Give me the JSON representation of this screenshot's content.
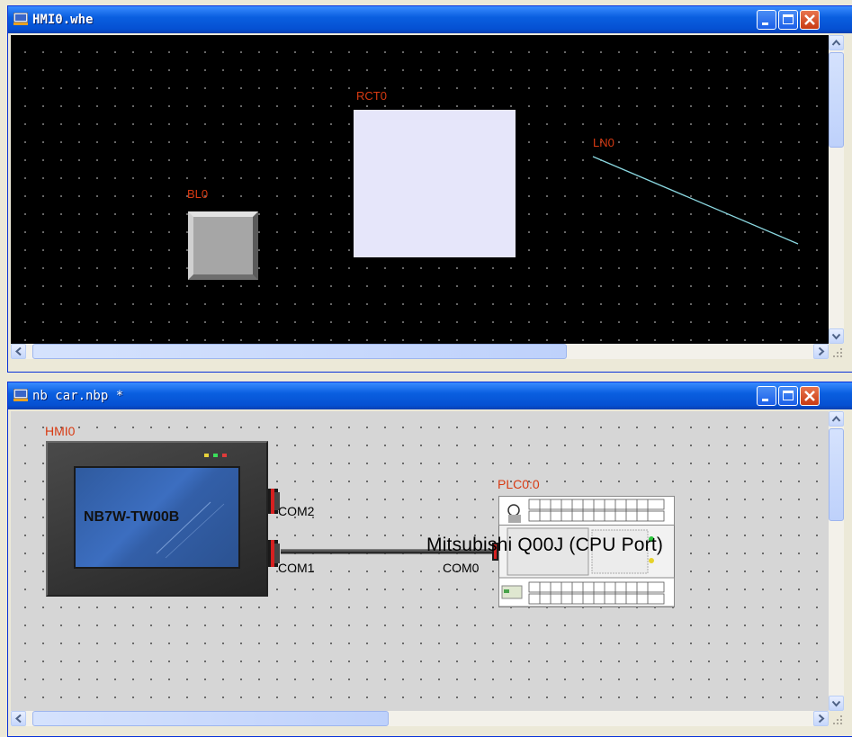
{
  "window1": {
    "title": "HMI0.whe",
    "objects": {
      "button_label": "BL0",
      "rect_label": "RCT0",
      "line_label": "LN0"
    }
  },
  "window2": {
    "title": "nb car.nbp *",
    "hmi": {
      "label": "HMI0",
      "model": "NB7W-TW00B",
      "ports": [
        "COM2",
        "COM1"
      ]
    },
    "plc": {
      "label": "PLC0:0",
      "model": "Mitsubishi Q00J (CPU Port)",
      "port": "COM0"
    }
  },
  "icons": [
    "app-window-icon",
    "minimize-icon",
    "maximize-icon",
    "close-icon",
    "scroll-up-icon",
    "scroll-down-icon",
    "scroll-left-icon",
    "scroll-right-icon",
    "size-grip-icon"
  ],
  "colors": {
    "titlebar": "#0a5fe0",
    "canvas_dark": "#000000",
    "canvas_light": "#d6d6d6",
    "object_label": "#d83a12",
    "line_object": "#8ad7e0"
  }
}
